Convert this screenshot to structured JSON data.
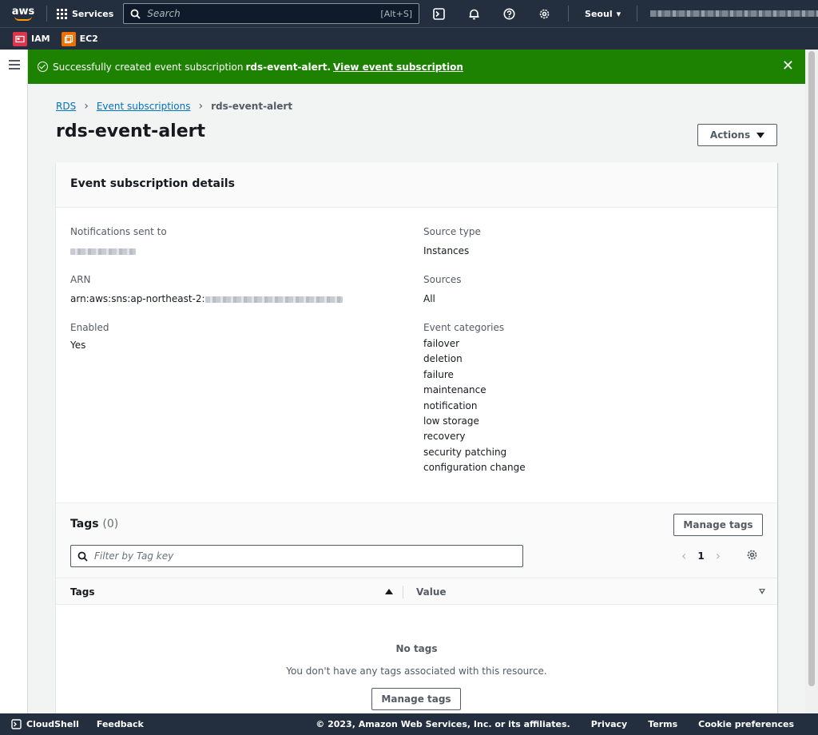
{
  "topnav": {
    "logo_text": "aws",
    "services_label": "Services",
    "search_placeholder": "Search",
    "search_shortcut": "[Alt+S]",
    "region": "Seoul"
  },
  "favorites": [
    {
      "label": "IAM",
      "color": "#dd344c"
    },
    {
      "label": "EC2",
      "color": "#ed7100"
    }
  ],
  "flash": {
    "prefix": "Successfully created event subscription",
    "name": "rds-event-alert.",
    "link": "View event subscription",
    "color": "#1d8102"
  },
  "breadcrumb": {
    "items": [
      "RDS",
      "Event subscriptions"
    ],
    "current": "rds-event-alert"
  },
  "page_title": "rds-event-alert",
  "actions_label": "Actions",
  "details": {
    "header": "Event subscription details",
    "notifications_label": "Notifications sent to",
    "arn_label": "ARN",
    "arn_prefix": "arn:aws:sns:ap-northeast-2:",
    "enabled_label": "Enabled",
    "enabled_value": "Yes",
    "source_type_label": "Source type",
    "source_type_value": "Instances",
    "sources_label": "Sources",
    "sources_value": "All",
    "event_categories_label": "Event categories",
    "event_categories": [
      "failover",
      "deletion",
      "failure",
      "maintenance",
      "notification",
      "low storage",
      "recovery",
      "security patching",
      "configuration change"
    ]
  },
  "tags": {
    "title": "Tags",
    "count": "(0)",
    "manage_label": "Manage tags",
    "filter_placeholder": "Filter by Tag key",
    "page": "1",
    "col_tags": "Tags",
    "col_value": "Value",
    "empty_title": "No tags",
    "empty_desc": "You don't have any tags associated with this resource."
  },
  "footer": {
    "cloudshell": "CloudShell",
    "feedback": "Feedback",
    "copyright": "© 2023, Amazon Web Services, Inc. or its affiliates.",
    "privacy": "Privacy",
    "terms": "Terms",
    "cookie": "Cookie preferences"
  }
}
